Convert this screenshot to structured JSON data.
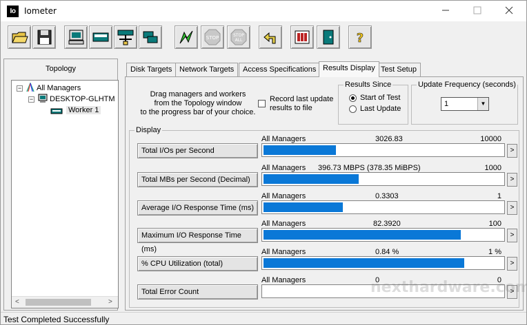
{
  "window": {
    "title": "Iometer",
    "icon_text": "Io"
  },
  "toolbar": {
    "buttons": [
      {
        "name": "open-config-button",
        "icon": "folder-open-icon"
      },
      {
        "name": "save-config-button",
        "icon": "floppy-disk-icon"
      },
      {
        "name": "start-disk-worker-button",
        "icon": "computer-disk-icon"
      },
      {
        "name": "start-network-worker-button",
        "icon": "drive-icon"
      },
      {
        "name": "add-network-worker-button",
        "icon": "network-icon"
      },
      {
        "name": "duplicate-worker-button",
        "icon": "duplicate-icon"
      },
      {
        "name": "start-tests-button",
        "icon": "green-flag-icon"
      },
      {
        "name": "stop-test-button",
        "icon": "stop-sign-icon",
        "label": "STOP"
      },
      {
        "name": "stop-all-button",
        "icon": "stop-all-icon",
        "label": "STOP",
        "label2": "ALL"
      },
      {
        "name": "reset-workers-button",
        "icon": "undo-arrow-icon"
      },
      {
        "name": "exit-button",
        "icon": "exit-door-icon"
      },
      {
        "name": "about-button",
        "icon": "help-question-icon",
        "label": "?"
      }
    ]
  },
  "topology": {
    "title": "Topology",
    "all_managers": "All Managers",
    "manager": "DESKTOP-GLHTM",
    "worker": "Worker 1"
  },
  "tabs": [
    {
      "label": "Disk Targets"
    },
    {
      "label": "Network Targets"
    },
    {
      "label": "Access Specifications"
    },
    {
      "label": "Results Display",
      "active": true
    },
    {
      "label": "Test Setup"
    }
  ],
  "drag_hint": [
    "Drag managers and workers",
    "from the Topology window",
    "to the progress bar of your choice."
  ],
  "record_update": [
    "Record last update",
    "results to file"
  ],
  "results_since": {
    "title": "Results Since",
    "options": [
      "Start of Test",
      "Last Update"
    ],
    "selected": 0
  },
  "update_frequency": {
    "title": "Update Frequency (seconds)",
    "value": "1"
  },
  "display": {
    "title": "Display",
    "rows": [
      {
        "button": "Total I/Os per Second",
        "source": "All Managers",
        "value": "3026.83",
        "max": "10000",
        "fill": 0.3027
      },
      {
        "button": "Total MBs per Second (Decimal)",
        "source": "All Managers",
        "value": "396.73 MBPS (378.35 MiBPS)",
        "max": "1000",
        "fill": 0.3967
      },
      {
        "button": "Average I/O Response Time (ms)",
        "source": "All Managers",
        "value": "0.3303",
        "max": "1",
        "fill": 0.3303
      },
      {
        "button": "Maximum I/O Response Time (ms)",
        "source": "All Managers",
        "value": "82.3920",
        "max": "100",
        "fill": 0.8239
      },
      {
        "button": "% CPU Utilization (total)",
        "source": "All Managers",
        "value": "0.84 %",
        "max": "1 %",
        "fill": 0.84
      },
      {
        "button": "Total Error Count",
        "source": "All Managers",
        "value": "0",
        "max": "0",
        "fill": 0
      }
    ],
    "more_label": ">"
  },
  "status": "Test Completed Successfully",
  "watermark": "nexthardware.com",
  "colors": {
    "bar": "#0a78d7"
  }
}
